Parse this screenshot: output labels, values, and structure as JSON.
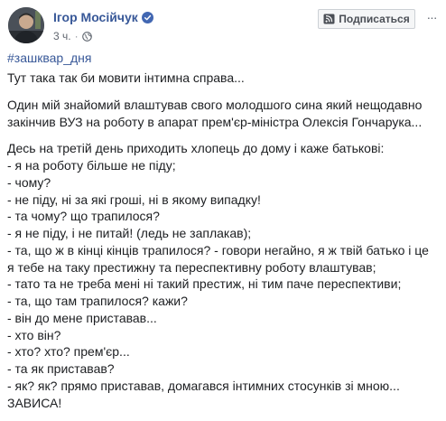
{
  "post": {
    "author": {
      "name": "Ігор Мосійчук",
      "verified": true,
      "verified_color": "#4267b2"
    },
    "meta": {
      "time": "3 ч.",
      "separator": "·",
      "privacy_icon": "globe-icon"
    },
    "actions": {
      "subscribe_label": "Подписаться",
      "subscribe_icon": "rss-icon",
      "more_label": "···"
    },
    "hashtag": "#зашквар_дня",
    "paragraphs": [
      {
        "lines": [
          "Тут така так би мовити інтимна справа..."
        ]
      },
      {
        "lines": [
          "Один мій знайомий влаштував свого молодшого сина який нещодавно",
          "закінчив ВУЗ на роботу в апарат прем'єр-міністра Олексія Гончарука..."
        ]
      },
      {
        "lines": [
          "Десь на третій день приходить хлопець до дому і каже батькові:",
          "- я на роботу більше не піду;",
          "- чому?",
          "- не піду, ні за які гроші, ні в якому випадку!",
          "- та чому? що трапилося?",
          "- я не піду, і не питай! (ледь не заплакав);",
          "- та, що ж в кінці кінців трапилося? - говори негайно, я ж твій батько і це",
          "я тебе на таку престижну та переспективну роботу влаштував;",
          "- тато та не треба мені ні такий престиж, ні тим паче переспективи;",
          "- та, що там трапилося? кажи?",
          "- він до мене приставав...",
          "- хто він?",
          "- хто? хто? прем'єр...",
          "- та як приставав?",
          "- як? як? прямо приставав, домагався інтимних стосунків зі мною...",
          "ЗАВИСА!"
        ]
      }
    ],
    "colors": {
      "link": "#385898",
      "text": "#1c1e21",
      "meta": "#616770"
    }
  }
}
